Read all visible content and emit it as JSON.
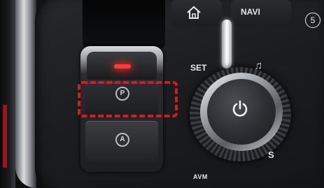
{
  "console": {
    "home_button": {
      "icon": "home-icon"
    },
    "navi_button": {
      "label": "NAVI"
    },
    "set_button": {
      "label": "SET"
    },
    "music_button": {
      "icon": "music-note-icon"
    },
    "knob": {
      "icon": "power-icon",
      "mode_label": "S"
    },
    "avm_button": {
      "label": "AVM"
    },
    "epb": {
      "park_icon": "P",
      "auto_hold_icon": "A",
      "led_color": "#ff3a3a",
      "highlight_color": "#d01c24"
    },
    "step_number": "5"
  }
}
